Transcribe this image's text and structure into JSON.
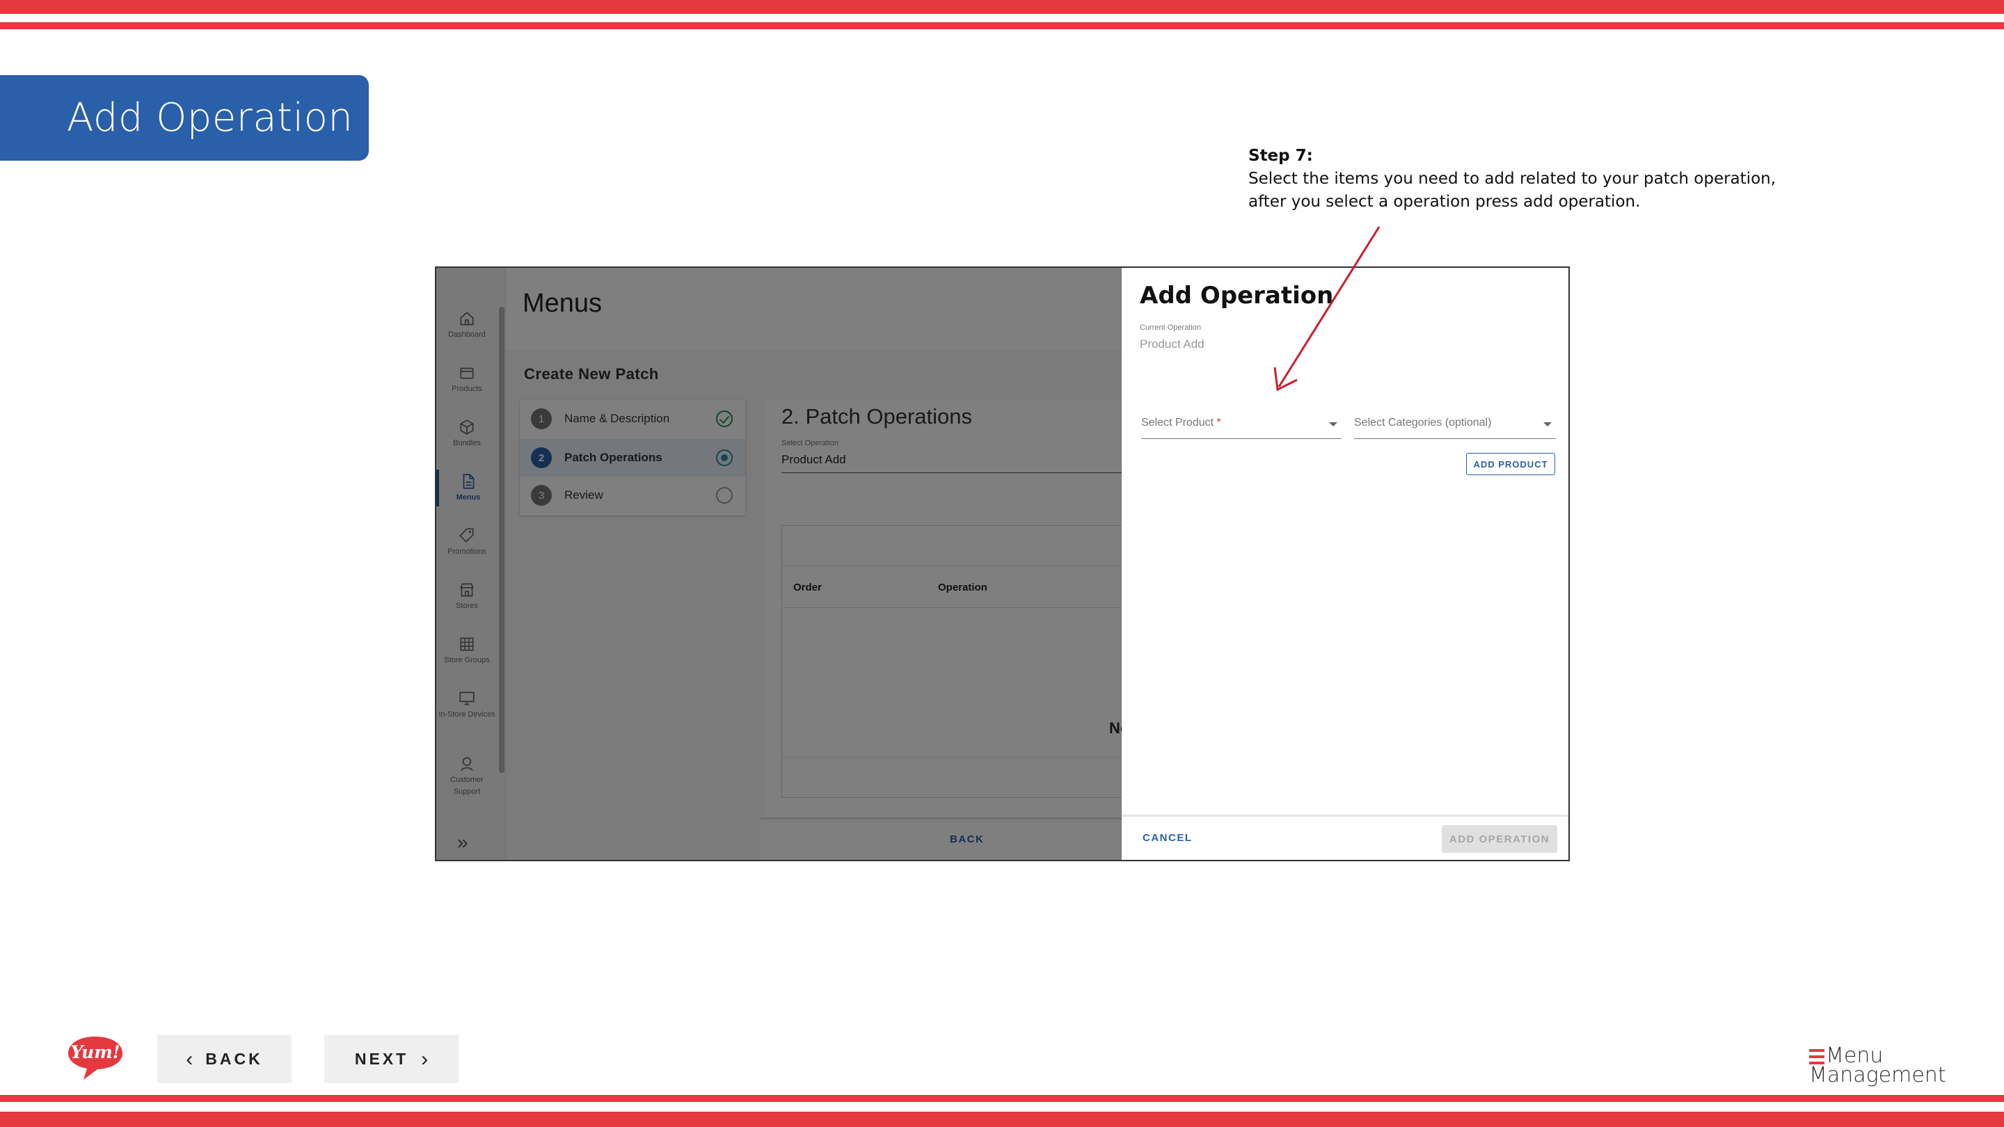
{
  "colors": {
    "accent_red": "#e5383f",
    "banner_blue": "#2a5fa9"
  },
  "slide": {
    "title": "Add Operation",
    "step_title": "Step 7:",
    "step_text": "Select the items you need to add related to your patch operation, after you select a operation press add operation."
  },
  "app": {
    "sidebar": {
      "items": [
        {
          "label": "Dashboard",
          "icon": "home-icon"
        },
        {
          "label": "Products",
          "icon": "box-icon"
        },
        {
          "label": "Bundles",
          "icon": "cube-icon"
        },
        {
          "label": "Menus",
          "icon": "document-icon"
        },
        {
          "label": "Promotions",
          "icon": "tag-icon"
        },
        {
          "label": "Stores",
          "icon": "store-icon"
        },
        {
          "label": "Store Groups",
          "icon": "grid-icon"
        },
        {
          "label": "In-Store Devices",
          "icon": "monitor-icon"
        },
        {
          "label": "Customer Support",
          "icon": "support-icon"
        }
      ],
      "active": "Menus",
      "expand_icon": "double-chevron-right-icon"
    },
    "page_title": "Menus",
    "section_title": "Create New Patch",
    "stepper": [
      {
        "num": "1",
        "label": "Name & Description",
        "status": "complete"
      },
      {
        "num": "2",
        "label": "Patch Operations",
        "status": "current"
      },
      {
        "num": "3",
        "label": "Review",
        "status": "pending"
      }
    ],
    "operations": {
      "title": "2. Patch Operations",
      "select_label": "Select Operation",
      "select_value": "Product Add",
      "columns": [
        "Order",
        "Operation"
      ],
      "empty_text": "No",
      "back_label": "BACK"
    },
    "drawer": {
      "title": "Add Operation",
      "current_label": "Current Operation",
      "current_value": "Product Add",
      "product_placeholder": "Select Product",
      "product_required": "*",
      "categories_placeholder": "Select Categories (optional)",
      "add_product_label": "ADD PRODUCT",
      "cancel_label": "CANCEL",
      "add_operation_label": "ADD OPERATION"
    }
  },
  "nav": {
    "back_label": "BACK",
    "next_label": "NEXT"
  },
  "logos": {
    "yum": "Yum!",
    "mm_line1": "Menu",
    "mm_line2": "Management"
  }
}
